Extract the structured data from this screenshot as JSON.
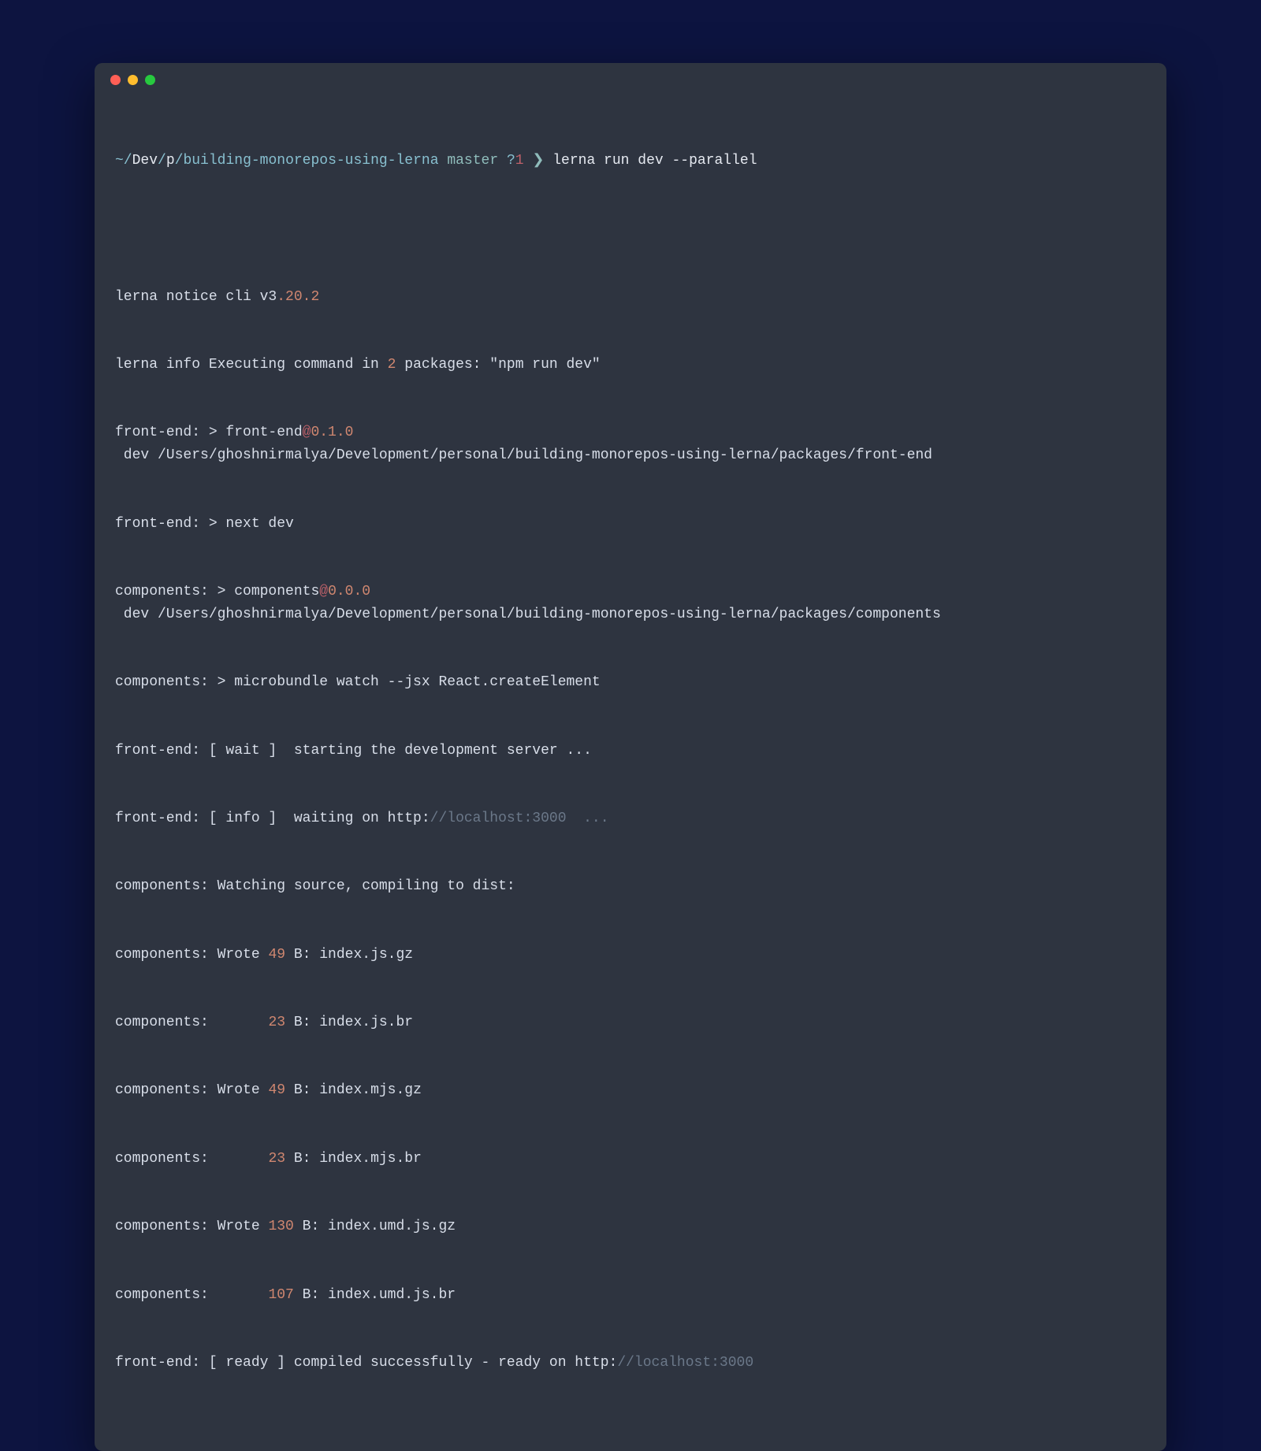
{
  "prompt": {
    "path_prefix": "~/",
    "path_dev": "Dev",
    "slash1": "/",
    "path_p": "p",
    "slash2": "/",
    "path_repo": "building-monorepos-using-lerna ",
    "branch": "master ",
    "status_q": "?",
    "status_num": "1 ",
    "arrow": "❯ ",
    "command": "lerna run dev --parallel"
  },
  "lines": {
    "l1_a": "lerna notice cli v3",
    "l1_b": ".20.2",
    "l2_a": "lerna info Executing command in ",
    "l2_b": "2",
    "l2_c": " packages: \"npm run dev\"",
    "l3_a": "front-end: > front-end",
    "l3_at": "@",
    "l3_ver": "0.1.0",
    "l3_c": " dev /Users/ghoshnirmalya/Development/personal/building-monorepos-using-lerna/packages/front-end",
    "l4": "front-end: > next dev",
    "l5_a": "components: > components",
    "l5_at": "@",
    "l5_ver": "0.0.0",
    "l5_c": " dev /Users/ghoshnirmalya/Development/personal/building-monorepos-using-lerna/packages/components",
    "l6": "components: > microbundle watch --jsx React.createElement",
    "l7": "front-end: [ wait ]  starting the development server ...",
    "l8_a": "front-end: [ info ]  waiting on http:",
    "l8_b": "//localhost:3000  ...",
    "l9": "components: Watching source, compiling to dist:",
    "l10_a": "components: Wrote ",
    "l10_b": "49",
    "l10_c": " B: index.js.gz",
    "l11_a": "components:       ",
    "l11_b": "23",
    "l11_c": " B: index.js.br",
    "l12_a": "components: Wrote ",
    "l12_b": "49",
    "l12_c": " B: index.mjs.gz",
    "l13_a": "components:       ",
    "l13_b": "23",
    "l13_c": " B: index.mjs.br",
    "l14_a": "components: Wrote ",
    "l14_b": "130",
    "l14_c": " B: index.umd.js.gz",
    "l15_a": "components:       ",
    "l15_b": "107",
    "l15_c": " B: index.umd.js.br",
    "l16_a": "front-end: [ ready ] compiled successfully - ready on http:",
    "l16_b": "//localhost:3000"
  }
}
